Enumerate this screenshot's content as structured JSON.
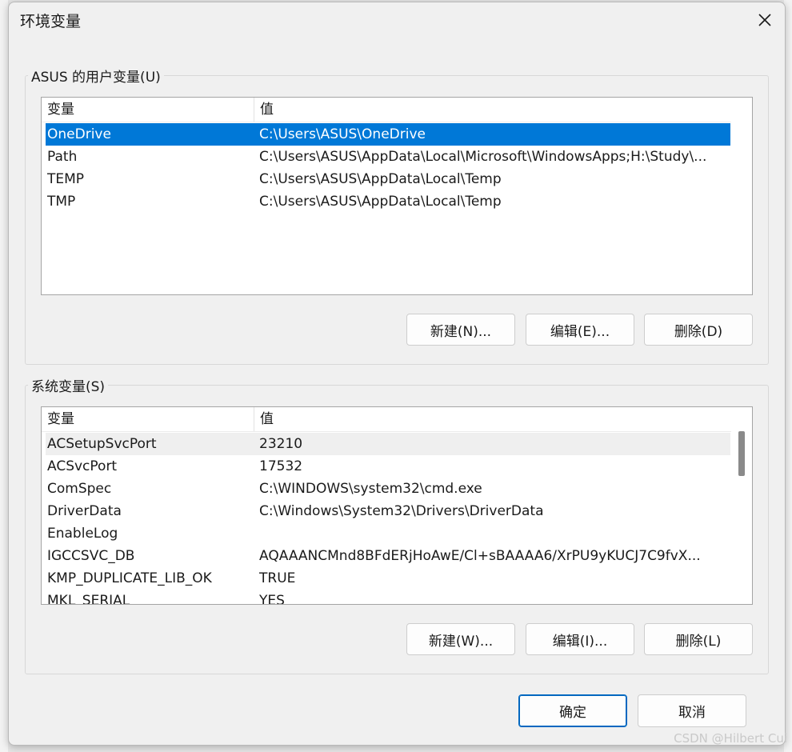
{
  "window": {
    "title": "环境变量"
  },
  "user_vars": {
    "group_label": "ASUS 的用户变量(U)",
    "columns": [
      "变量",
      "值"
    ],
    "rows": [
      {
        "name": "OneDrive",
        "value": "C:\\Users\\ASUS\\OneDrive"
      },
      {
        "name": "Path",
        "value": "C:\\Users\\ASUS\\AppData\\Local\\Microsoft\\WindowsApps;H:\\Study\\..."
      },
      {
        "name": "TEMP",
        "value": "C:\\Users\\ASUS\\AppData\\Local\\Temp"
      },
      {
        "name": "TMP",
        "value": "C:\\Users\\ASUS\\AppData\\Local\\Temp"
      }
    ],
    "selected_row": 0,
    "buttons": {
      "new": "新建(N)...",
      "edit": "编辑(E)...",
      "delete": "删除(D)"
    }
  },
  "system_vars": {
    "group_label": "系统变量(S)",
    "columns": [
      "变量",
      "值"
    ],
    "rows": [
      {
        "name": "ACSetupSvcPort",
        "value": "23210"
      },
      {
        "name": "ACSvcPort",
        "value": "17532"
      },
      {
        "name": "ComSpec",
        "value": "C:\\WINDOWS\\system32\\cmd.exe"
      },
      {
        "name": "DriverData",
        "value": "C:\\Windows\\System32\\Drivers\\DriverData"
      },
      {
        "name": "EnableLog",
        "value": ""
      },
      {
        "name": "IGCCSVC_DB",
        "value": "AQAAANCMnd8BFdERjHoAwE/Cl+sBAAAA6/XrPU9yKUCJ7C9fvX..."
      },
      {
        "name": "KMP_DUPLICATE_LIB_OK",
        "value": "TRUE"
      },
      {
        "name": "MKL_SERIAL",
        "value": "YES"
      }
    ],
    "hover_row": 0,
    "scroll_position": 0.0,
    "buttons": {
      "new": "新建(W)...",
      "edit": "编辑(I)...",
      "delete": "删除(L)"
    }
  },
  "footer": {
    "ok": "确定",
    "cancel": "取消"
  },
  "watermark": "CSDN @Hilbert Cui",
  "colors": {
    "selection": "#0078d7",
    "primary_border": "#0067c0"
  }
}
